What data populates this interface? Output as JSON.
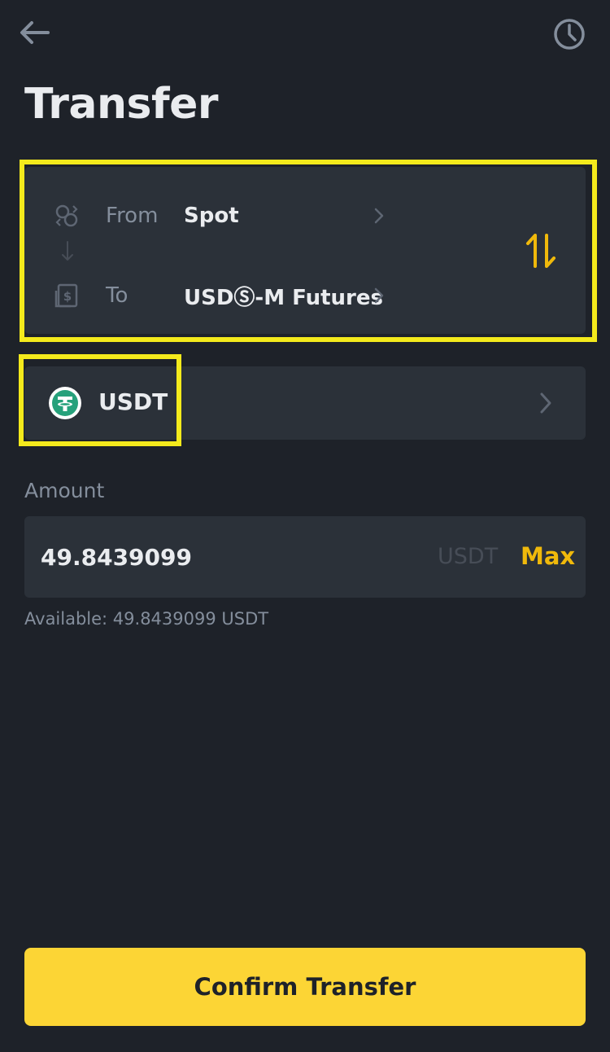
{
  "header": {
    "title": "Transfer",
    "back_icon": "arrow-left-icon",
    "history_icon": "clock-icon"
  },
  "transfer": {
    "from_label": "From",
    "from_value": "Spot",
    "from_icon": "wallet-exchange-icon",
    "to_label": "To",
    "to_value": "USDⓈ-M Futures",
    "to_icon": "futures-wallet-icon",
    "swap_icon": "swap-vertical-icon"
  },
  "coin": {
    "symbol": "USDT",
    "logo_icon": "tether-logo-icon",
    "logo_color": "#26a17b"
  },
  "amount": {
    "label": "Amount",
    "value": "49.8439099",
    "unit": "USDT",
    "max_label": "Max",
    "available_text": "Available: 49.8439099 USDT"
  },
  "footer": {
    "confirm_label": "Confirm Transfer"
  },
  "colors": {
    "background": "#1e2229",
    "card": "#2b3139",
    "accent": "#f0b90b",
    "button": "#fcd535",
    "highlight": "#f4ea1c"
  }
}
